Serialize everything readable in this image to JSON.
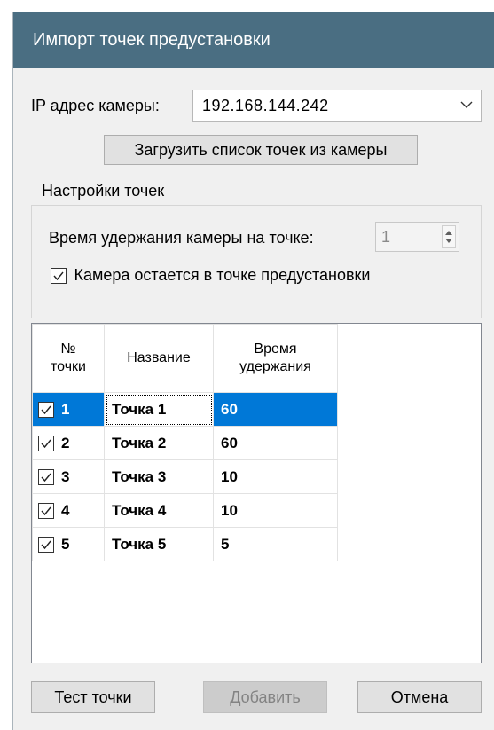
{
  "window": {
    "title": "Импорт точек предустановки"
  },
  "camera": {
    "label": "IP адрес камеры:",
    "ip": "192.168.144.242",
    "load_button": "Загрузить список точек из камеры"
  },
  "settings": {
    "group_title": "Настройки точек",
    "hold_label": "Время удержания камеры на точке:",
    "hold_value": "1",
    "stay_checked": true,
    "stay_label": "Камера остается в точке предустановки"
  },
  "table": {
    "headers": {
      "num_line1": "№",
      "num_line2": "точки",
      "name": "Название",
      "time_line1": "Время",
      "time_line2": "удержания"
    },
    "rows": [
      {
        "num": "1",
        "name": "Точка 1",
        "time": "60",
        "checked": true,
        "selected": true
      },
      {
        "num": "2",
        "name": "Точка 2",
        "time": "60",
        "checked": true,
        "selected": false
      },
      {
        "num": "3",
        "name": "Точка 3",
        "time": "10",
        "checked": true,
        "selected": false
      },
      {
        "num": "4",
        "name": "Точка 4",
        "time": "10",
        "checked": true,
        "selected": false
      },
      {
        "num": "5",
        "name": "Точка 5",
        "time": "5",
        "checked": true,
        "selected": false
      }
    ]
  },
  "buttons": {
    "test": "Тест точки",
    "add": "Добавить",
    "cancel": "Отмена"
  },
  "colors": {
    "titlebar": "#4a6e82",
    "selection": "#0078d7"
  }
}
